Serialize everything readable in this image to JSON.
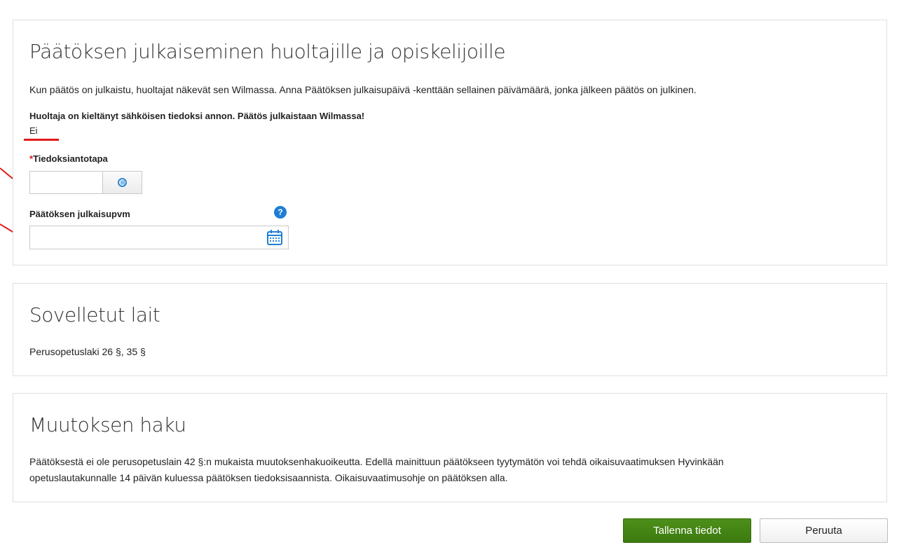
{
  "publish": {
    "title": "Päätöksen julkaiseminen huoltajille ja opiskelijoille",
    "description": "Kun päätös on julkaistu, huoltajat näkevät sen Wilmassa. Anna Päätöksen julkaisupäivä -kenttään sellainen päivämäärä, jonka jälkeen päätös on julkinen.",
    "guardian_notice_label": "Huoltaja on kieltänyt sähköisen tiedoksi annon. Päätös julkaistaan Wilmassa!",
    "guardian_notice_value": "Ei",
    "notification_method": {
      "required_mark": "*",
      "label": "Tiedoksiantotapa",
      "value": ""
    },
    "publish_date": {
      "label": "Päätöksen julkaisupvm",
      "value": "",
      "help": "?"
    }
  },
  "laws": {
    "title": "Sovelletut lait",
    "text": "Perusopetuslaki 26 §, 35 §"
  },
  "appeal": {
    "title": "Muutoksen haku",
    "line1": "Päätöksestä ei ole perusopetuslain 42 §:n mukaista muutoksenhakuoikeutta. Edellä mainittuun päätökseen tyytymätön voi tehdä oikaisuvaatimuksen Hyvinkään",
    "line2": "opetuslautakunnalle 14 päivän kuluessa päätöksen tiedoksisaannista. Oikaisuvaatimusohje on päätöksen alla."
  },
  "actions": {
    "save_label": "Tallenna tiedot",
    "cancel_label": "Peruuta"
  },
  "colors": {
    "accent_blue": "#1f7ed4",
    "save_green": "#3c7a0f",
    "annotation_red": "#e21a1a"
  }
}
